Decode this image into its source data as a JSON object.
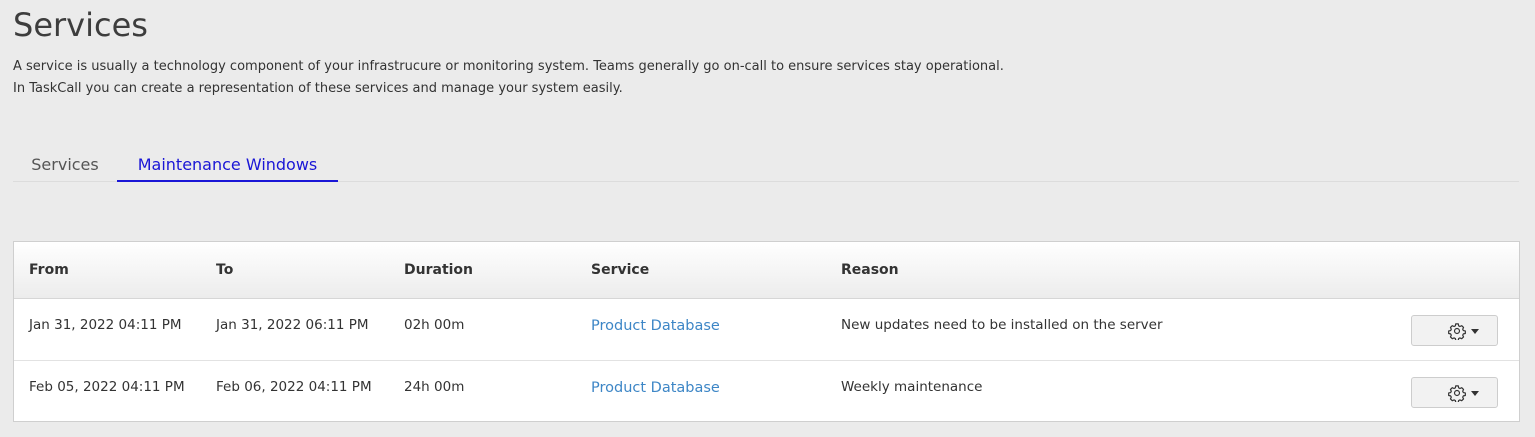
{
  "header": {
    "title": "Services",
    "description_line1": "A service is usually a technology component of your infrastrucure or monitoring system. Teams generally go on-call to ensure services stay operational.",
    "description_line2": "In TaskCall you can create a representation of these services and manage your system easily."
  },
  "tabs": [
    {
      "label": "Services",
      "active": false
    },
    {
      "label": "Maintenance Windows",
      "active": true
    }
  ],
  "table": {
    "columns": [
      "From",
      "To",
      "Duration",
      "Service",
      "Reason"
    ],
    "rows": [
      {
        "from": "Jan 31, 2022 04:11 PM",
        "to": "Jan 31, 2022 06:11 PM",
        "duration": "02h 00m",
        "service": "Product Database",
        "reason": "New updates need to be installed on the server",
        "action_icon": "gear-icon"
      },
      {
        "from": "Feb 05, 2022 04:11 PM",
        "to": "Feb 06, 2022 04:11 PM",
        "duration": "24h 00m",
        "service": "Product Database",
        "reason": "Weekly maintenance",
        "action_icon": "gear-icon"
      }
    ]
  },
  "colors": {
    "active_tab": "#1a16d6",
    "link": "#3d86c6",
    "background": "#ebebeb"
  }
}
